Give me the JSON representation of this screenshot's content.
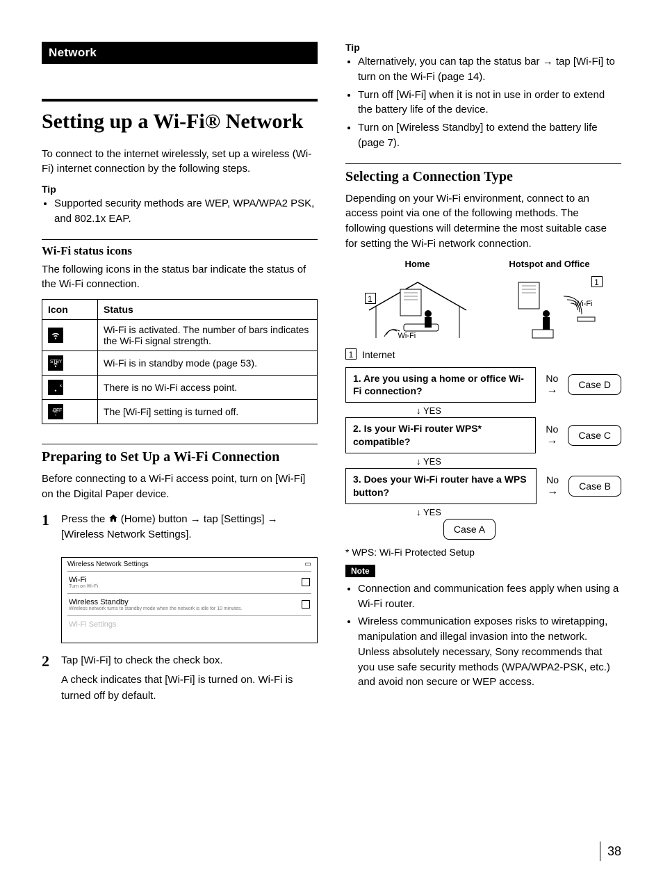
{
  "page_number": "38",
  "left": {
    "section_tag": "Network",
    "h1": "Setting up a Wi-Fi® Network",
    "intro": "To connect to the internet wirelessly, set up a wireless (Wi-Fi) internet connection by the following steps.",
    "tip_label": "Tip",
    "tip1": "Supported security methods are WEP, WPA/WPA2 PSK, and 802.1x EAP.",
    "icons_heading": "Wi-Fi status icons",
    "icons_intro": "The following icons in the status bar indicate the status of the Wi-Fi connection.",
    "table": {
      "h_icon": "Icon",
      "h_status": "Status",
      "rows": [
        {
          "sub": "",
          "status": "Wi-Fi is activated. The number of bars indicates the Wi-Fi signal strength."
        },
        {
          "sub": "STBY",
          "status": "Wi-Fi is in standby mode (page 53)."
        },
        {
          "sub": "×",
          "status": "There is no Wi-Fi access point."
        },
        {
          "sub": "OFF",
          "status": "The [Wi-Fi] setting is turned off."
        }
      ]
    },
    "prep_heading": "Preparing to Set Up a Wi-Fi Connection",
    "prep_intro": "Before connecting to a Wi-Fi access point, turn on [Wi-Fi] on the Digital Paper device.",
    "step1": {
      "num": "1",
      "text_a": "Press the ",
      "home_label": " (Home) button ",
      "text_b": " tap [Settings] ",
      "text_c": " [Wireless Network Settings]."
    },
    "screenshot": {
      "title": "Wireless Network Settings",
      "row1": {
        "label": "Wi-Fi",
        "sub": "Turn on Wi-Fi"
      },
      "row2": {
        "label": "Wireless Standby",
        "sub": "Wireless network turns to standby mode when the network is idle for 10 minutes."
      },
      "row3": {
        "label": "Wi-Fi Settings"
      }
    },
    "step2": {
      "num": "2",
      "line1": "Tap [Wi-Fi] to check the check box.",
      "line2": "A check indicates that [Wi-Fi] is turned on. Wi-Fi is turned off by default."
    }
  },
  "right": {
    "tip_label": "Tip",
    "tips": [
      "Alternatively, you can tap the status bar → tap [Wi-Fi] to turn on the Wi-Fi (page 14).",
      "Turn off [Wi-Fi] when it is not in use in order to extend the battery life of the device.",
      "Turn on [Wireless Standby] to extend the battery life (page 7)."
    ],
    "select_heading": "Selecting a Connection Type",
    "select_intro": "Depending on your Wi-Fi environment, connect to an access point via one of the following methods. The following questions will determine the most suitable case for setting the Wi-Fi network connection.",
    "env": {
      "home": "Home",
      "hotspot": "Hotspot and Office",
      "wifi": "Wi-Fi"
    },
    "legend": {
      "num": "1",
      "label": "Internet"
    },
    "flow": {
      "q1": "1. Are you using a home or office Wi-Fi connection?",
      "q2": "2. Is your Wi-Fi router WPS* compatible?",
      "q3": "3. Does your Wi-Fi router have a WPS button?",
      "no": "No",
      "yes": "YES",
      "case_a": "Case A",
      "case_b": "Case B",
      "case_c": "Case C",
      "case_d": "Case D"
    },
    "footnote": "* WPS: Wi-Fi Protected Setup",
    "note_label": "Note",
    "notes": [
      "Connection and communication fees apply when using a Wi-Fi router.",
      "Wireless communication exposes risks to wiretapping, manipulation and illegal invasion into the network.\nUnless absolutely necessary, Sony recommends that you use safe security methods (WPA/WPA2-PSK, etc.) and avoid non secure or WEP access."
    ]
  }
}
